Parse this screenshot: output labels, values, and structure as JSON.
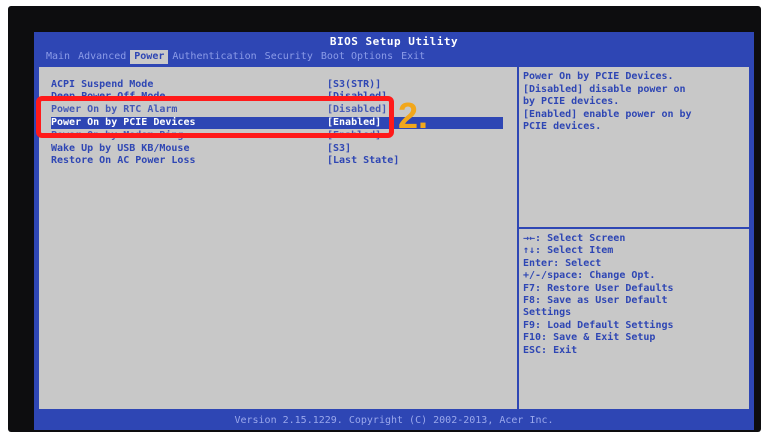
{
  "bios": {
    "title": "BIOS Setup Utility",
    "tabs": [
      {
        "label": "Main",
        "active": false
      },
      {
        "label": "Advanced",
        "active": false
      },
      {
        "label": "Power",
        "active": true
      },
      {
        "label": "Authentication",
        "active": false
      },
      {
        "label": "Security",
        "active": false
      },
      {
        "label": "Boot Options",
        "active": false
      },
      {
        "label": "Exit",
        "active": false
      }
    ],
    "settings": [
      {
        "label": "ACPI Suspend Mode",
        "value": "[S3(STR)]"
      },
      {
        "label": "Deep Power Off Mode",
        "value": "[Disabled]"
      },
      {
        "label": "Power On by RTC Alarm",
        "value": "[Disabled]"
      },
      {
        "label": "Power On by PCIE Devices",
        "value": "[Enabled]",
        "selected": true
      },
      {
        "label": "Power On by Modem Ring",
        "value": "[Enabled]"
      },
      {
        "label": "Wake Up by USB KB/Mouse",
        "value": "[S3]"
      },
      {
        "label": "Restore On AC Power Loss",
        "value": "[Last State]"
      }
    ],
    "help_text": "Power On by PCIE Devices.\n[Disabled] disable power on\nby PCIE devices.\n[Enabled] enable power on by\nPCIE devices.",
    "keys": [
      "→←: Select Screen",
      "↑↓: Select Item",
      "Enter: Select",
      "+/-/space: Change Opt.",
      "F7: Restore User Defaults",
      "F8: Save as User Default",
      "Settings",
      "F9: Load Default Settings",
      "F10: Save & Exit Setup",
      "ESC: Exit"
    ],
    "footer": "Version 2.15.1229. Copyright (C) 2002-2013, Acer Inc."
  },
  "annotation": {
    "label": "2.",
    "color": "#ff1a1a",
    "label_color": "#f2a71b"
  },
  "colors": {
    "bios_blue": "#2e46b4",
    "panel_gray": "#c8c8c8"
  }
}
